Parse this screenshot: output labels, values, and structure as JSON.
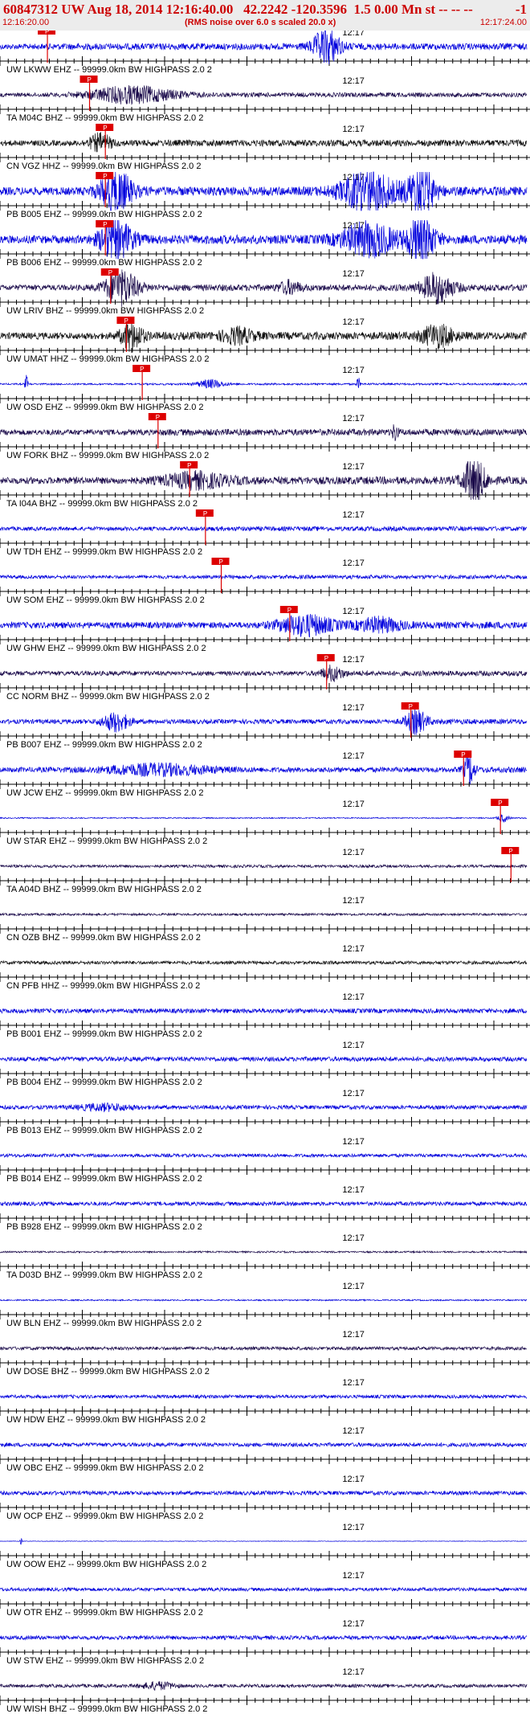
{
  "header": {
    "title": "60847312 UW Aug 18, 2014 12:16:40.00   42.2242 -120.3596  1.5 0.00 Mn st -- -- --",
    "title_suffix": "-1",
    "start_time": "12:16:20.00",
    "note": "(RMS noise over 6.0 s scaled 20.0 x)",
    "end_time": "12:17:24.00"
  },
  "colors": {
    "blue": "#0000dd",
    "dark": "#1a0a4a",
    "black": "#111111",
    "pick": "#dd0000",
    "axis": "#000000"
  },
  "chart_data": {
    "type": "line",
    "title": "60847312 UW Aug 18, 2014 12:16:40.00   42.2242 -120.3596  1.5 0.00 Mn st -- -- --",
    "xlabel": "",
    "ylabel": "",
    "x_range": [
      "12:16:20.00",
      "12:17:24.00"
    ],
    "minute_tick_label": "12:17",
    "pick_label": "P",
    "grid": false,
    "channels": [
      {
        "label": "UW LKWW EHZ -- 99999.0km BW  HIGHPASS  2.0  2",
        "color": "blue",
        "pick": 0.09,
        "bursts": [
          [
            0.62,
            0.025,
            6
          ]
        ],
        "amp": 0.5
      },
      {
        "label": "TA M04C BHZ -- 99999.0km BW  HIGHPASS  2.0  2",
        "color": "dark",
        "pick": 0.17,
        "bursts": [
          [
            0.25,
            0.08,
            4
          ]
        ],
        "amp": 0.35
      },
      {
        "label": "CN VGZ HHZ -- 99999.0km BW  HIGHPASS  2.0  2",
        "color": "black",
        "pick": 0.2,
        "bursts": [
          [
            0.19,
            0.02,
            3
          ]
        ],
        "amp": 0.5
      },
      {
        "label": "PB B005 EHZ -- 99999.0km BW  HIGHPASS  2.0  2",
        "color": "blue",
        "pick": 0.2,
        "bursts": [
          [
            0.22,
            0.03,
            5
          ],
          [
            0.7,
            0.05,
            5
          ],
          [
            0.8,
            0.025,
            6
          ]
        ],
        "amp": 0.7
      },
      {
        "label": "PB B006 EHZ -- 99999.0km BW  HIGHPASS  2.0  2",
        "color": "blue",
        "pick": 0.2,
        "bursts": [
          [
            0.22,
            0.03,
            5
          ],
          [
            0.7,
            0.05,
            4
          ],
          [
            0.8,
            0.025,
            6
          ]
        ],
        "amp": 0.7
      },
      {
        "label": "UW LRIV BHZ -- 99999.0km BW  HIGHPASS  2.0  2",
        "color": "dark",
        "pick": 0.21,
        "bursts": [
          [
            0.23,
            0.03,
            6
          ],
          [
            0.55,
            0.02,
            2
          ],
          [
            0.83,
            0.03,
            5
          ]
        ],
        "amp": 0.5
      },
      {
        "label": "UW UMAT HHZ -- 99999.0km BW  HIGHPASS  2.0  2",
        "color": "black",
        "pick": 0.24,
        "bursts": [
          [
            0.25,
            0.02,
            4
          ],
          [
            0.45,
            0.03,
            2
          ],
          [
            0.83,
            0.03,
            3
          ]
        ],
        "amp": 0.6
      },
      {
        "label": "UW OSD EHZ -- 99999.0km BW  HIGHPASS  2.0  2",
        "color": "blue",
        "pick": 0.27,
        "bursts": [
          [
            0.05,
            0.003,
            10
          ],
          [
            0.4,
            0.025,
            5
          ],
          [
            0.68,
            0.003,
            8
          ]
        ],
        "amp": 0.15
      },
      {
        "label": "UW FORK BHZ -- 99999.0km BW  HIGHPASS  2.0  2",
        "color": "dark",
        "pick": 0.3,
        "bursts": [
          [
            0.75,
            0.005,
            3
          ]
        ],
        "amp": 0.5
      },
      {
        "label": "TA I04A BHZ -- 99999.0km BW  HIGHPASS  2.0  2",
        "color": "dark",
        "pick": 0.36,
        "bursts": [
          [
            0.37,
            0.06,
            2
          ],
          [
            0.9,
            0.02,
            7
          ]
        ],
        "amp": 0.6
      },
      {
        "label": "UW TDH EHZ -- 99999.0km BW  HIGHPASS  2.0  2",
        "color": "blue",
        "pick": 0.39,
        "bursts": [],
        "amp": 0.35
      },
      {
        "label": "UW SOM EHZ -- 99999.0km BW  HIGHPASS  2.0  2",
        "color": "blue",
        "pick": 0.42,
        "bursts": [],
        "amp": 0.3
      },
      {
        "label": "UW GHW EHZ -- 99999.0km BW  HIGHPASS  2.0  2",
        "color": "blue",
        "pick": 0.55,
        "bursts": [
          [
            0.58,
            0.05,
            3
          ],
          [
            0.72,
            0.04,
            2
          ]
        ],
        "amp": 0.55
      },
      {
        "label": "CC NORM BHZ -- 99999.0km BW  HIGHPASS  2.0  2",
        "color": "dark",
        "pick": 0.62,
        "bursts": [
          [
            0.63,
            0.02,
            3
          ]
        ],
        "amp": 0.4
      },
      {
        "label": "PB B007 EHZ -- 99999.0km BW  HIGHPASS  2.0  2",
        "color": "blue",
        "pick": 0.78,
        "bursts": [
          [
            0.22,
            0.025,
            4
          ],
          [
            0.79,
            0.02,
            5
          ]
        ],
        "amp": 0.4
      },
      {
        "label": "UW JCW EHZ -- 99999.0km BW  HIGHPASS  2.0  2",
        "color": "blue",
        "pick": 0.88,
        "bursts": [
          [
            0.3,
            0.1,
            2
          ],
          [
            0.89,
            0.01,
            6
          ]
        ],
        "amp": 0.45
      },
      {
        "label": "UW STAR EHZ -- 99999.0km BW  HIGHPASS  2.0  2",
        "color": "blue",
        "pick": 0.95,
        "bursts": [
          [
            0.955,
            0.01,
            7
          ]
        ],
        "amp": 0.1
      },
      {
        "label": "TA A04D BHZ -- 99999.0km BW  HIGHPASS  2.0  2",
        "color": "dark",
        "pick": 0.97,
        "bursts": [],
        "amp": 0.25
      },
      {
        "label": "CN OZB BHZ -- 99999.0km BW  HIGHPASS  2.0  2",
        "color": "dark",
        "pick": null,
        "bursts": [],
        "amp": 0.2
      },
      {
        "label": "CN PFB HHZ -- 99999.0km BW  HIGHPASS  2.0  2",
        "color": "black",
        "pick": null,
        "bursts": [],
        "amp": 0.3
      },
      {
        "label": "PB B001 EHZ -- 99999.0km BW  HIGHPASS  2.0  2",
        "color": "blue",
        "pick": null,
        "bursts": [],
        "amp": 0.4
      },
      {
        "label": "PB B004 EHZ -- 99999.0km BW  HIGHPASS  2.0  2",
        "color": "blue",
        "pick": null,
        "bursts": [],
        "amp": 0.4
      },
      {
        "label": "PB B013 EHZ -- 99999.0km BW  HIGHPASS  2.0  2",
        "color": "blue",
        "pick": null,
        "bursts": [
          [
            0.2,
            0.05,
            1.5
          ]
        ],
        "amp": 0.35
      },
      {
        "label": "PB B014 EHZ -- 99999.0km BW  HIGHPASS  2.0  2",
        "color": "blue",
        "pick": null,
        "bursts": [],
        "amp": 0.3
      },
      {
        "label": "PB B928 EHZ -- 99999.0km BW  HIGHPASS  2.0  2",
        "color": "blue",
        "pick": null,
        "bursts": [],
        "amp": 0.35
      },
      {
        "label": "TA D03D BHZ -- 99999.0km BW  HIGHPASS  2.0  2",
        "color": "dark",
        "pick": null,
        "bursts": [],
        "amp": 0.15
      },
      {
        "label": "UW BLN EHZ -- 99999.0km BW  HIGHPASS  2.0  2",
        "color": "blue",
        "pick": null,
        "bursts": [],
        "amp": 0.12
      },
      {
        "label": "UW DOSE BHZ -- 99999.0km BW  HIGHPASS  2.0  2",
        "color": "dark",
        "pick": null,
        "bursts": [],
        "amp": 0.3
      },
      {
        "label": "UW HDW EHZ -- 99999.0km BW  HIGHPASS  2.0  2",
        "color": "blue",
        "pick": null,
        "bursts": [],
        "amp": 0.3
      },
      {
        "label": "UW OBC EHZ -- 99999.0km BW  HIGHPASS  2.0  2",
        "color": "blue",
        "pick": null,
        "bursts": [],
        "amp": 0.35
      },
      {
        "label": "UW OCP EHZ -- 99999.0km BW  HIGHPASS  2.0  2",
        "color": "blue",
        "pick": null,
        "bursts": [],
        "amp": 0.35
      },
      {
        "label": "UW OOW EHZ -- 99999.0km BW  HIGHPASS  2.0  2",
        "color": "blue",
        "pick": null,
        "bursts": [
          [
            0.04,
            0.002,
            12
          ]
        ],
        "amp": 0.05
      },
      {
        "label": "UW OTR EHZ -- 99999.0km BW  HIGHPASS  2.0  2",
        "color": "blue",
        "pick": null,
        "bursts": [],
        "amp": 0.3
      },
      {
        "label": "UW STW EHZ -- 99999.0km BW  HIGHPASS  2.0  2",
        "color": "blue",
        "pick": null,
        "bursts": [],
        "amp": 0.35
      },
      {
        "label": "UW WISH BHZ -- 99999.0km BW  HIGHPASS  2.0  2",
        "color": "dark",
        "pick": null,
        "bursts": [
          [
            0.3,
            0.03,
            2
          ]
        ],
        "amp": 0.3
      }
    ]
  }
}
